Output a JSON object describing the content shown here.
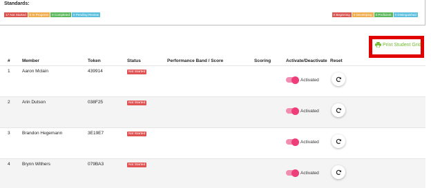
{
  "standards": {
    "title": "Standards:",
    "status_badges": [
      {
        "label": "17 Not Started",
        "color": "#d9534f"
      },
      {
        "label": "0 In Progress",
        "color": "#f0ad4e"
      },
      {
        "label": "0 Completed",
        "color": "#5cb85c"
      },
      {
        "label": "0 Pending Review",
        "color": "#5bc0de"
      }
    ],
    "level_badges": [
      {
        "label": "0 Beginning",
        "color": "#d9534f"
      },
      {
        "label": "0 Developing",
        "color": "#f0ad4e"
      },
      {
        "label": "0 Proficient",
        "color": "#5cb85c"
      },
      {
        "label": "0 Distinguished",
        "color": "#5bc0de"
      }
    ]
  },
  "actions": {
    "print_label": "Print Student Grid",
    "print_color": "#6dbb2f",
    "print_icon": "printer-icon"
  },
  "table": {
    "columns": [
      "#",
      "Member",
      "Token",
      "Status",
      "Performance Band / Score",
      "Scoring",
      "Activate/Deactivate",
      "Reset"
    ],
    "rows": [
      {
        "num": "1",
        "member": "Aaron Mclain",
        "token": "439914",
        "status": "Not Started",
        "toggle": "Activated"
      },
      {
        "num": "2",
        "member": "Arin Dutson",
        "token": "038F25",
        "status": "Not Started",
        "toggle": "Activated"
      },
      {
        "num": "3",
        "member": "Brandon Hegemann",
        "token": "3E19E7",
        "status": "Not Started",
        "toggle": "Activated"
      },
      {
        "num": "4",
        "member": "Brynn Withers",
        "token": "079BA3",
        "status": "Not Started",
        "toggle": "Activated"
      }
    ]
  },
  "colors": {
    "toggle_on": "#ee3d79",
    "status_not_started": "#e05252",
    "highlight_border": "#e00000"
  }
}
